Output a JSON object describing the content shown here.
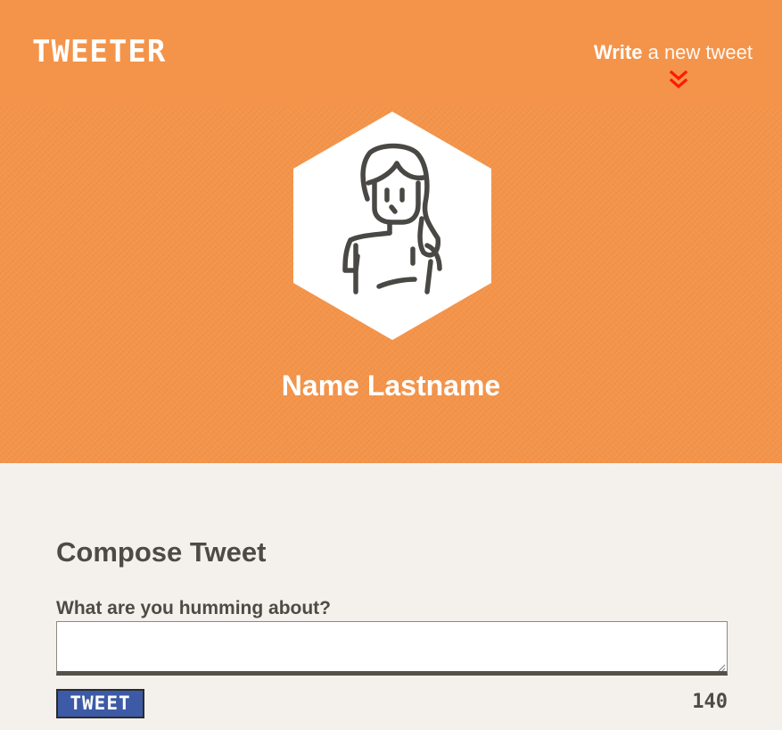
{
  "navbar": {
    "brand": "TWEETER",
    "compose_link": {
      "strong": "Write",
      "rest": " a new tweet",
      "icon": "double-chevron-down-icon"
    }
  },
  "profile": {
    "avatar_icon": "woman-avatar-icon",
    "name": "Name Lastname"
  },
  "compose": {
    "title": "Compose Tweet",
    "label": "What are you humming about?",
    "textarea_value": "",
    "button_label": "TWEET",
    "counter": "140"
  },
  "colors": {
    "header_orange": "#f4944a",
    "page_background": "#f4f1ec",
    "text_dark": "#4c4b46",
    "button_blue": "#3d5aa6",
    "chevron_red": "#ff1a00"
  }
}
